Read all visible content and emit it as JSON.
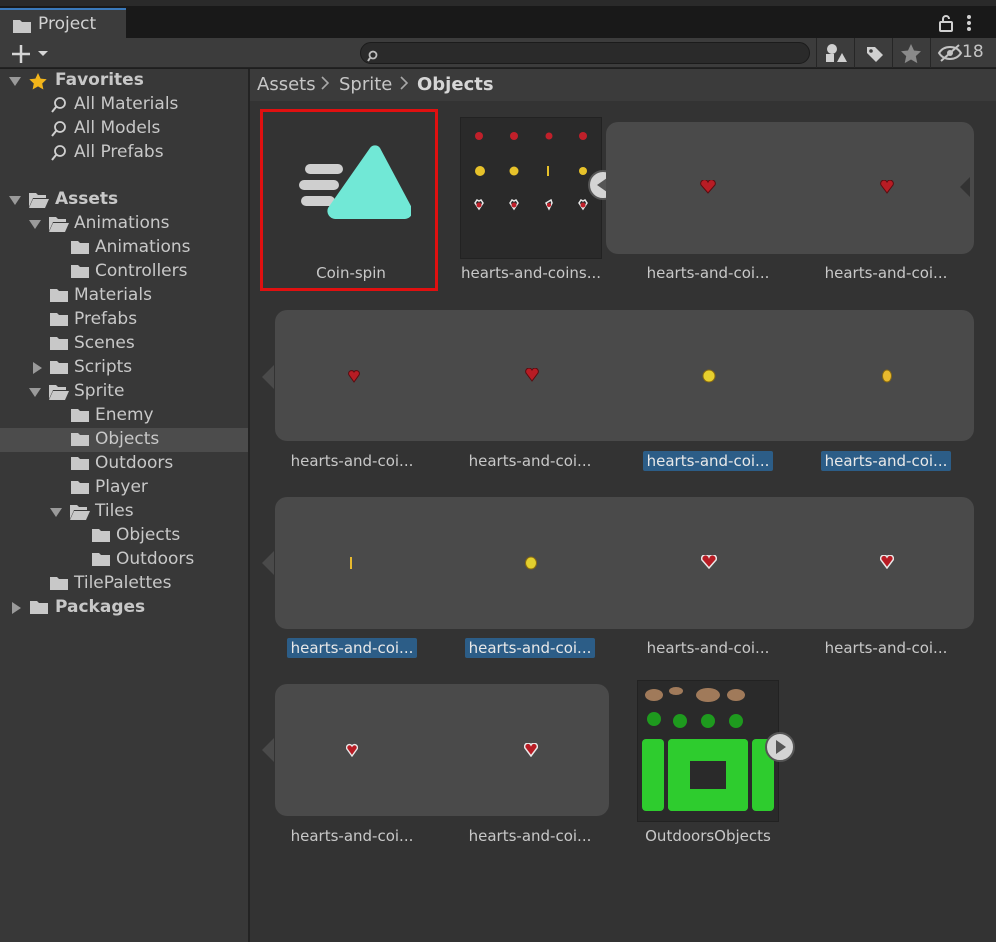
{
  "window": {
    "tab_label": "Project",
    "hidden_count": "18"
  },
  "search": {
    "placeholder": ""
  },
  "favorites": {
    "title": "Favorites",
    "items": [
      "All Materials",
      "All Models",
      "All Prefabs"
    ]
  },
  "tree": {
    "assets": "Assets",
    "animations": "Animations",
    "animations_sub": "Animations",
    "controllers": "Controllers",
    "materials": "Materials",
    "prefabs": "Prefabs",
    "scenes": "Scenes",
    "scripts": "Scripts",
    "sprite": "Sprite",
    "enemy": "Enemy",
    "objects": "Objects",
    "outdoors": "Outdoors",
    "player": "Player",
    "tiles": "Tiles",
    "tiles_objects": "Objects",
    "tiles_outdoors": "Outdoors",
    "tilepalettes": "TilePalettes",
    "packages": "Packages"
  },
  "breadcrumb": [
    "Assets",
    "Sprite",
    "Objects"
  ],
  "assets": {
    "coin_spin": "Coin-spin",
    "sheet": "hearts-and-coins...",
    "sub": "hearts-and-coi...",
    "outdoors_objects": "OutdoorsObjects"
  },
  "colors": {
    "selection_outline": "#e01010",
    "selected_label_bg": "#2c5d87",
    "anim_icon": "#71e8d6",
    "favorite_star": "#f2b51a"
  }
}
